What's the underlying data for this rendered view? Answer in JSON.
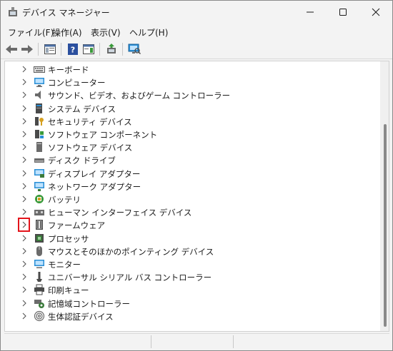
{
  "window": {
    "title": "デバイス マネージャー",
    "minimize_label": "Minimize",
    "maximize_label": "Maximize",
    "close_label": "Close"
  },
  "menu": {
    "items": [
      {
        "label": "ファイル(F)"
      },
      {
        "label": "操作(A)"
      },
      {
        "label": "表示(V)"
      },
      {
        "label": "ヘルプ(H)"
      }
    ]
  },
  "toolbar": {
    "buttons": [
      {
        "icon": "back-arrow-icon"
      },
      {
        "icon": "forward-arrow-icon"
      },
      {
        "icon": "show-hide-console-tree-icon"
      },
      {
        "icon": "help-icon"
      },
      {
        "icon": "show-action-pane-icon"
      },
      {
        "icon": "update-driver-icon"
      },
      {
        "icon": "scan-hardware-icon"
      }
    ]
  },
  "tree": {
    "items": [
      {
        "label": "キーボード",
        "icon": "keyboard-icon",
        "color": "#5b5b5b"
      },
      {
        "label": "コンピューター",
        "icon": "computer-icon",
        "color": "#2a8fd6"
      },
      {
        "label": "サウンド、ビデオ、およびゲーム コントローラー",
        "icon": "speaker-icon",
        "color": "#6b6b6b"
      },
      {
        "label": "システム デバイス",
        "icon": "system-device-icon",
        "color": "#2a8fd6"
      },
      {
        "label": "セキュリティ デバイス",
        "icon": "security-key-icon",
        "color": "#d6a020"
      },
      {
        "label": "ソフトウェア コンポーネント",
        "icon": "software-component-icon",
        "color": "#3a9a3a"
      },
      {
        "label": "ソフトウェア デバイス",
        "icon": "software-device-icon",
        "color": "#6b6b6b"
      },
      {
        "label": "ディスク ドライブ",
        "icon": "disk-drive-icon",
        "color": "#6b6b6b"
      },
      {
        "label": "ディスプレイ アダプター",
        "icon": "display-adapter-icon",
        "color": "#2a8fd6"
      },
      {
        "label": "ネットワーク アダプター",
        "icon": "network-adapter-icon",
        "color": "#2a8fd6"
      },
      {
        "label": "バッテリ",
        "icon": "battery-icon",
        "color": "#3a9a3a"
      },
      {
        "label": "ヒューマン インターフェイス デバイス",
        "icon": "hid-icon",
        "color": "#6b6b6b"
      },
      {
        "label": "ファームウェア",
        "icon": "firmware-icon",
        "color": "#4a4a4a",
        "highlighted": true
      },
      {
        "label": "プロセッサ",
        "icon": "processor-icon",
        "color": "#3a7a3a"
      },
      {
        "label": "マウスとそのほかのポインティング デバイス",
        "icon": "mouse-icon",
        "color": "#6b6b6b"
      },
      {
        "label": "モニター",
        "icon": "monitor-icon",
        "color": "#2a8fd6"
      },
      {
        "label": "ユニバーサル シリアル バス コントローラー",
        "icon": "usb-icon",
        "color": "#4a4a4a"
      },
      {
        "label": "印刷キュー",
        "icon": "printer-icon",
        "color": "#4a4a4a"
      },
      {
        "label": "記憶域コントローラー",
        "icon": "storage-controller-icon",
        "color": "#3a7a3a"
      },
      {
        "label": "生体認証デバイス",
        "icon": "biometric-icon",
        "color": "#6b6b6b"
      }
    ]
  },
  "colors": {
    "highlight_border": "#e4141b",
    "accent": "#2a8fd6"
  }
}
